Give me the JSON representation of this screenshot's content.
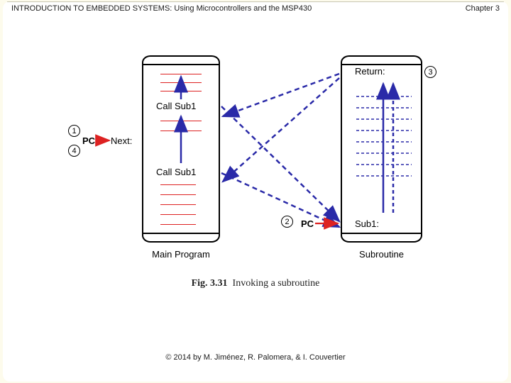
{
  "header": {
    "book_title": "INTRODUCTION TO EMBEDDED SYSTEMS: Using Microcontrollers and the MSP430",
    "chapter": "Chapter 3"
  },
  "footer": {
    "copyright": "© 2014 by M. Jiménez, R. Palomera, & I. Couvertier"
  },
  "figure": {
    "caption_label": "Fig. 3.31",
    "caption_text": "Invoking a subroutine",
    "main_program_label": "Main Program",
    "subroutine_label": "Subroutine",
    "call1_text": "Call Sub1",
    "call2_text": "Call Sub1",
    "next_text": "Next:",
    "return_text": "Return:",
    "sub_name": "Sub1:",
    "pc_label": "PC",
    "badges": {
      "b1": "1",
      "b2": "2",
      "b3": "3",
      "b4": "4"
    }
  }
}
